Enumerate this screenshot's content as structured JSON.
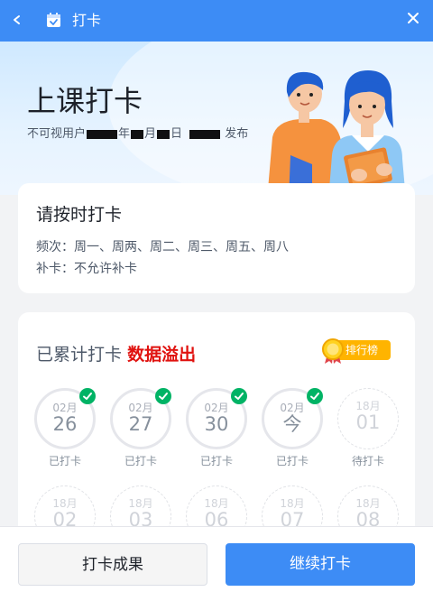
{
  "titlebar": {
    "title": "打卡"
  },
  "hero": {
    "title": "上课打卡",
    "meta": {
      "user": "不可视用户",
      "year_suffix": "年",
      "month_suffix": "月",
      "day_suffix": "日",
      "published": "发布"
    }
  },
  "rules": {
    "heading": "请按时打卡",
    "frequency": "频次：周一、周两、周二、周三、周五、周八",
    "makeup": "补卡：不允许补卡"
  },
  "stats": {
    "prefix": "已累计打卡",
    "highlight": "数据溢出",
    "rank_label": "排行榜"
  },
  "days": [
    {
      "month": "02月",
      "day": "26",
      "status": "已打卡",
      "checked": true
    },
    {
      "month": "02月",
      "day": "27",
      "status": "已打卡",
      "checked": true
    },
    {
      "month": "02月",
      "day": "30",
      "status": "已打卡",
      "checked": true
    },
    {
      "month": "02月",
      "day": "今",
      "status": "已打卡",
      "checked": true
    },
    {
      "month": "18月",
      "day": "01",
      "status": "待打卡",
      "checked": false
    },
    {
      "month": "18月",
      "day": "02",
      "status": "",
      "checked": false
    },
    {
      "month": "18月",
      "day": "03",
      "status": "",
      "checked": false
    },
    {
      "month": "18月",
      "day": "06",
      "status": "",
      "checked": false
    },
    {
      "month": "18月",
      "day": "07",
      "status": "",
      "checked": false
    },
    {
      "month": "18月",
      "day": "08",
      "status": "",
      "checked": false
    }
  ],
  "buttons": {
    "result": "打卡成果",
    "continue": "继续打卡"
  },
  "colors": {
    "accent": "#3d8cf5",
    "check": "#00b365",
    "highlight": "#e0120f",
    "rank": "#ffb400"
  }
}
